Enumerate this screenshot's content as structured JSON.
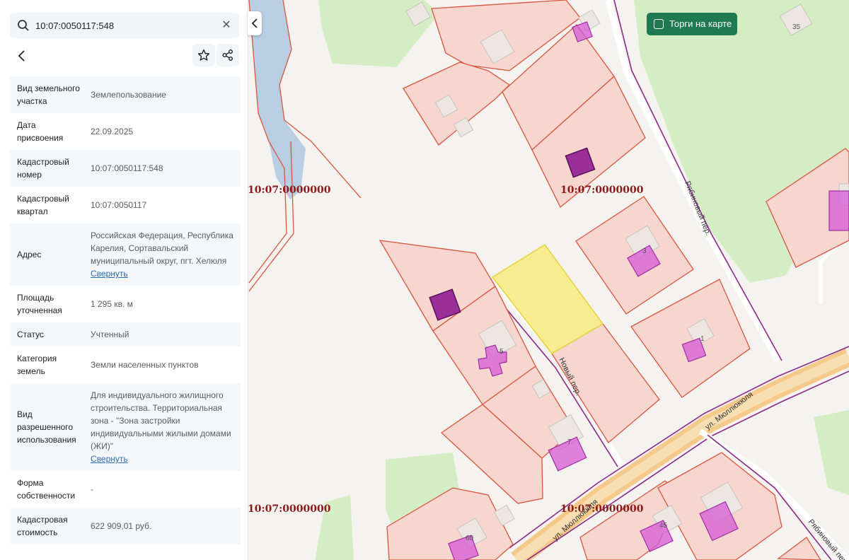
{
  "search": {
    "value": "10:07:0050117:548"
  },
  "details": [
    {
      "label": "Вид земельного участка",
      "value": "Землепользование"
    },
    {
      "label": "Дата присвоения",
      "value": "22.09.2025"
    },
    {
      "label": "Кадастровый номер",
      "value": "10:07:0050117:548"
    },
    {
      "label": "Кадастровый квартал",
      "value": "10:07:0050117"
    },
    {
      "label": "Адрес",
      "value": "Российская Федерация, Республика Карелия, Сортавальский муниципальный округ, пгт. Хелюля",
      "link": "Свернуть"
    },
    {
      "label": "Площадь уточненная",
      "value": "1 295 кв. м"
    },
    {
      "label": "Статус",
      "value": "Учтенный"
    },
    {
      "label": "Категория земель",
      "value": "Земли населенных пунктов"
    },
    {
      "label": "Вид разрешенного использования",
      "value": "Для индивидуального жилищного строительства. Территориальная зона - \"Зона застройки индивидуальными жилыми домами (ЖИ)\"",
      "link": "Свернуть"
    },
    {
      "label": "Форма собственности",
      "value": "-"
    },
    {
      "label": "Кадастровая стоимость",
      "value": "622 909,01 руб."
    }
  ],
  "map": {
    "auction_toggle": "Торги на карте",
    "quarter_labels": [
      "10:07:0000000",
      "10:07:0000000",
      "10:07:0000000",
      "10:07:0000000"
    ],
    "streets": [
      "Рябиновый пер.",
      "Новый пер.",
      "ул. Мюллюкюля",
      "ул. Мюллюкюля",
      "Рябиновый пер."
    ],
    "house_numbers": [
      "35",
      "3",
      "1",
      "7",
      "60",
      "45",
      "5"
    ]
  },
  "colors": {
    "parcel_fill": "#f6d6cf",
    "parcel_stroke": "#d9553f",
    "selected_fill": "#f7ec90",
    "building": "#d65ad6",
    "forest": "#d4edc4",
    "road": "#f5c98a",
    "accent": "#1f7a52"
  }
}
